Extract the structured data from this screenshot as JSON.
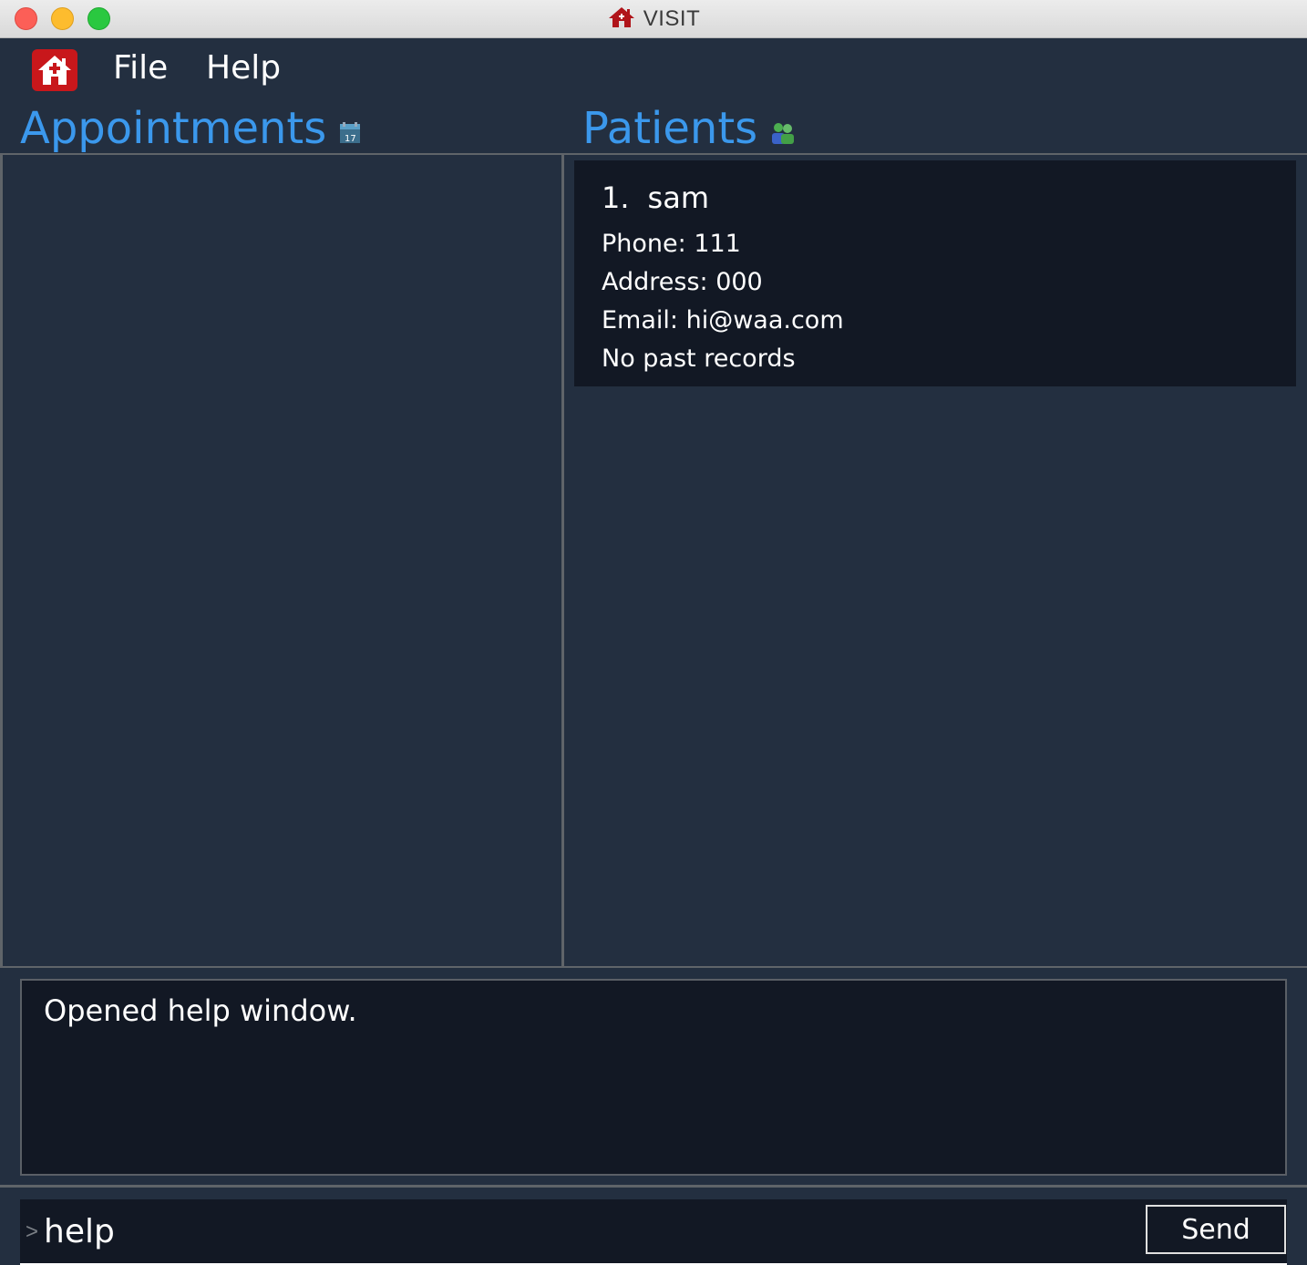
{
  "window": {
    "title": "VISIT",
    "title_icon": "house-icon",
    "controls": [
      "close",
      "minimize",
      "maximize"
    ]
  },
  "menubar": {
    "app_icon": "house-medical-icon",
    "items": [
      {
        "label": "File"
      },
      {
        "label": "Help"
      }
    ]
  },
  "appointments": {
    "title": "Appointments",
    "icon": "calendar-icon",
    "items": []
  },
  "patients": {
    "title": "Patients",
    "icon": "people-icon",
    "items": [
      {
        "index": "1.",
        "name": "sam",
        "phone": "Phone: 111",
        "address": "Address: 000",
        "email": "Email: hi@waa.com",
        "records": "No past records"
      }
    ]
  },
  "result_display": {
    "text": "Opened help window."
  },
  "command_box": {
    "prompt": ">",
    "value": "help",
    "send_label": "Send"
  },
  "colors": {
    "background": "#232f40",
    "card": "#121824",
    "accent": "#3b98ec",
    "app_icon": "#c8171b"
  }
}
